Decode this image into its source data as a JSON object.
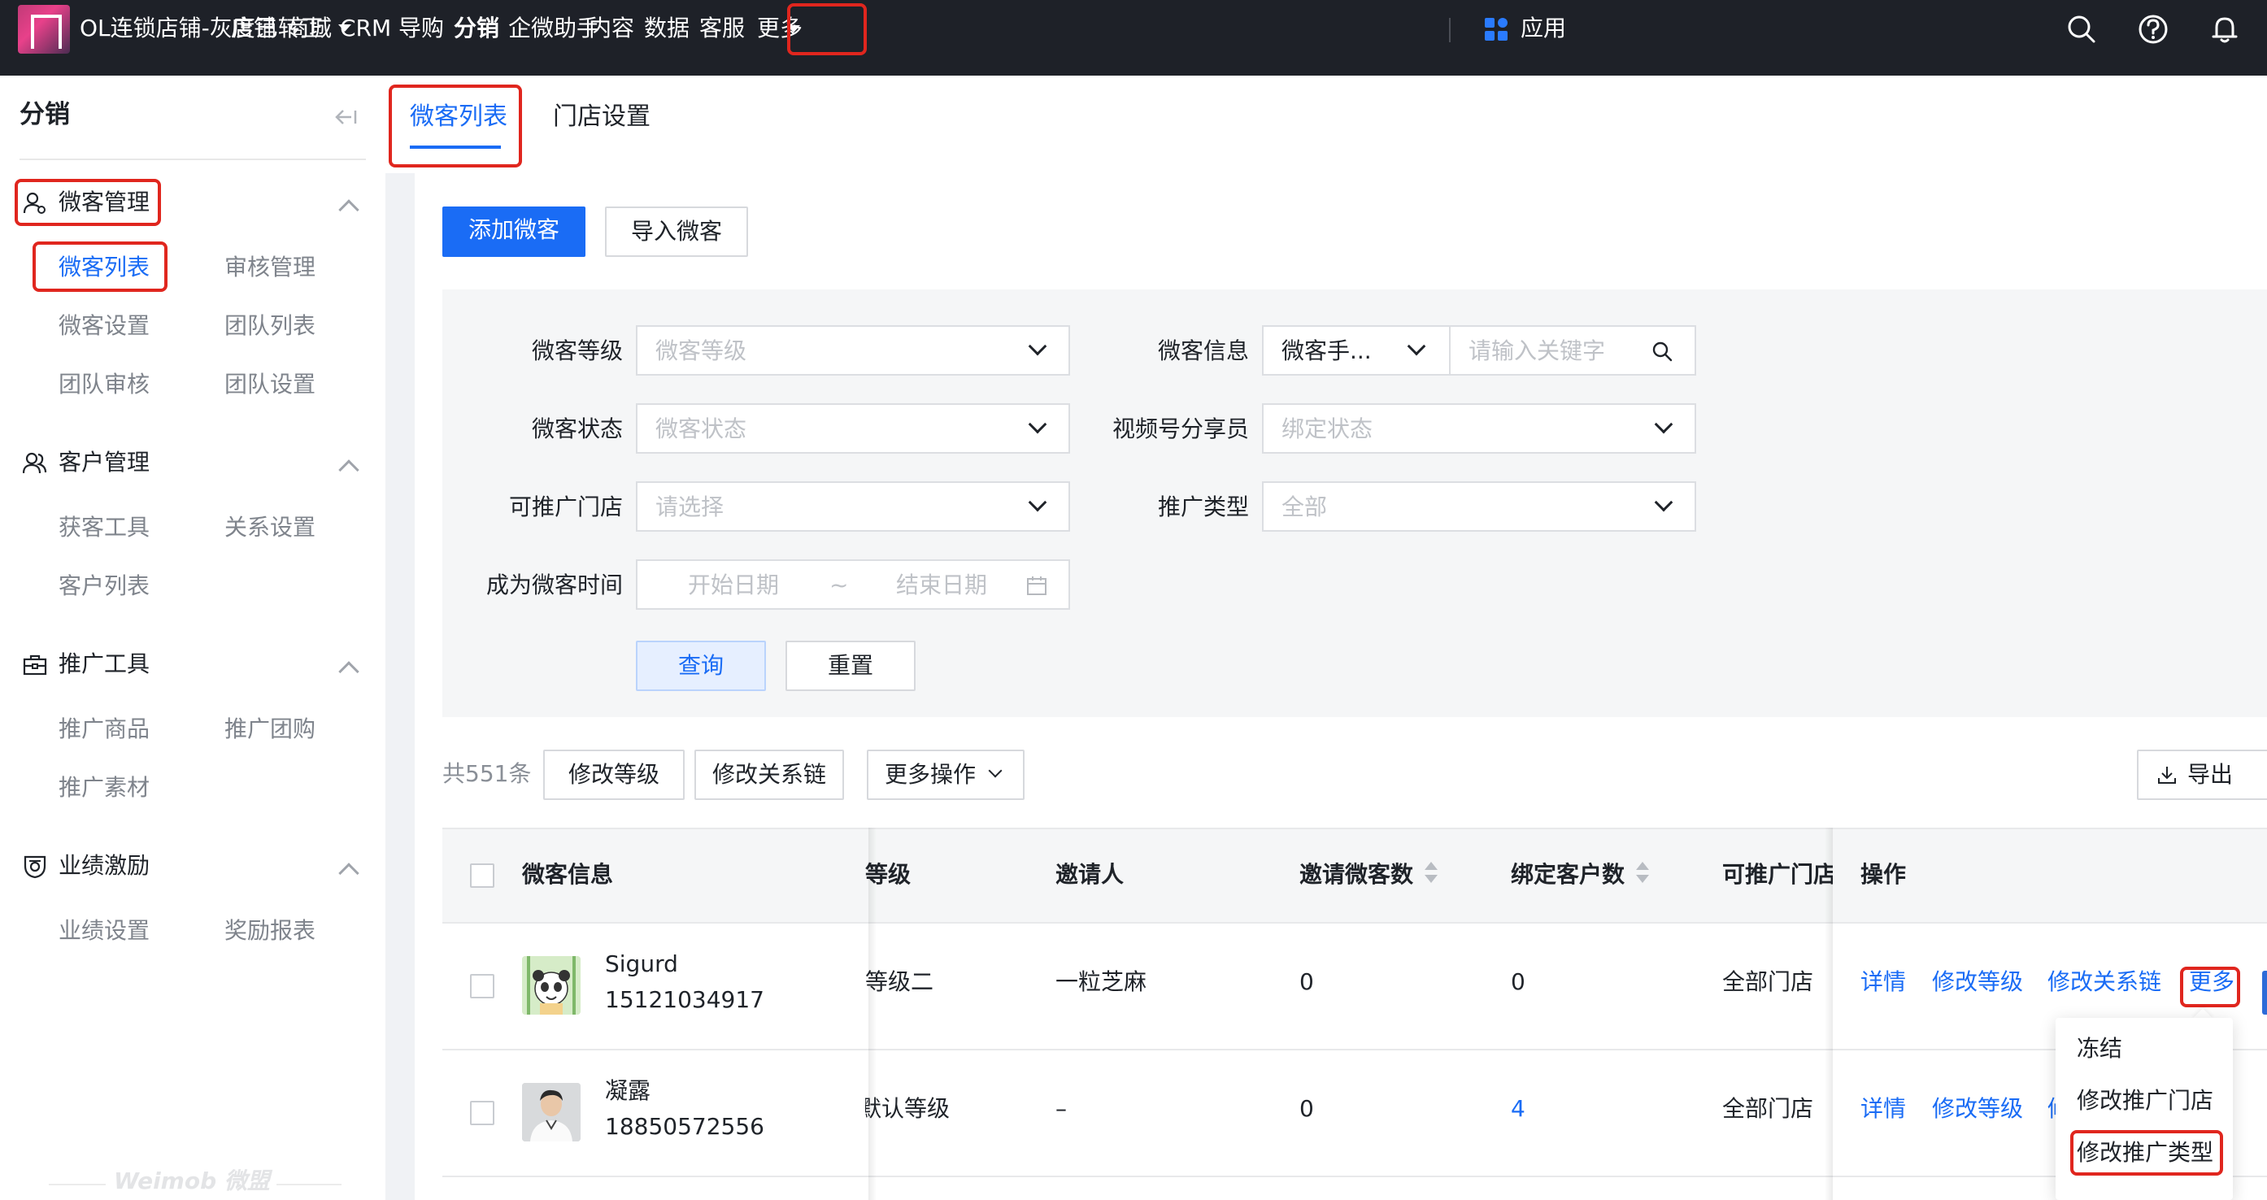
{
  "topbar": {
    "store_name": "OL连锁店铺-灰度已转正",
    "nav": [
      "店铺",
      "商城",
      "CRM",
      "导购",
      "分销",
      "企微助手",
      "内容",
      "数据",
      "客服",
      "更多"
    ],
    "active_nav": "分销",
    "app_label": "应用",
    "icons": [
      "search-icon",
      "help-icon",
      "bell-icon"
    ]
  },
  "sidebar": {
    "title": "分销",
    "groups": [
      {
        "label": "微客管理",
        "icon": "user-group-icon",
        "items": [
          "微客列表",
          "审核管理",
          "微客设置",
          "团队列表",
          "团队审核",
          "团队设置"
        ]
      },
      {
        "label": "客户管理",
        "icon": "users-icon",
        "items": [
          "获客工具",
          "关系设置",
          "客户列表"
        ]
      },
      {
        "label": "推广工具",
        "icon": "briefcase-icon",
        "items": [
          "推广商品",
          "推广团购",
          "推广素材"
        ]
      },
      {
        "label": "业绩激励",
        "icon": "medal-icon",
        "items": [
          "业绩设置",
          "奖励报表"
        ]
      }
    ],
    "active_item": "微客列表",
    "footer_logo": "Weimob 微盟"
  },
  "tabs": [
    "微客列表",
    "门店设置"
  ],
  "actions": {
    "add": "添加微客",
    "import": "导入微客"
  },
  "filters": {
    "level_label": "微客等级",
    "level_placeholder": "微客等级",
    "info_label": "微客信息",
    "info_type": "微客手...",
    "info_placeholder": "请输入关键字",
    "status_label": "微客状态",
    "status_placeholder": "微客状态",
    "video_label": "视频号分享员",
    "video_placeholder": "绑定状态",
    "store_label": "可推广门店",
    "store_placeholder": "请选择",
    "promo_label": "推广类型",
    "promo_value": "全部",
    "time_label": "成为微客时间",
    "start_placeholder": "开始日期",
    "range_sep": "~",
    "end_placeholder": "结束日期",
    "query": "查询",
    "reset": "重置"
  },
  "toolbar": {
    "total": "共551条",
    "modify_level": "修改等级",
    "modify_chain": "修改关系链",
    "more_ops": "更多操作",
    "export": "导出"
  },
  "table": {
    "headers": {
      "info": "微客信息",
      "level": "等级",
      "inviter": "邀请人",
      "invited": "邀请微客数",
      "bound": "绑定客户数",
      "stores": "可推广门店",
      "ops": "操作"
    },
    "rows": [
      {
        "name": "Sigurd",
        "phone": "15121034917",
        "level": "等级二",
        "inviter": "一粒芝麻",
        "invited": "0",
        "bound": "0",
        "stores": "全部门店"
      },
      {
        "name": "凝露",
        "phone": "18850572556",
        "level": "默认等级",
        "inviter": "–",
        "invited": "0",
        "bound": "4",
        "stores": "全部门店"
      }
    ],
    "row_actions": {
      "detail": "详情",
      "modify_level": "修改等级",
      "modify_chain": "修改关系链",
      "more": "更多"
    }
  },
  "more_menu": [
    "冻结",
    "修改推广门店",
    "修改推广类型"
  ],
  "colors": {
    "accent": "#1a6cf5",
    "topbar": "#1e2128",
    "highlight": "#e0261e"
  }
}
